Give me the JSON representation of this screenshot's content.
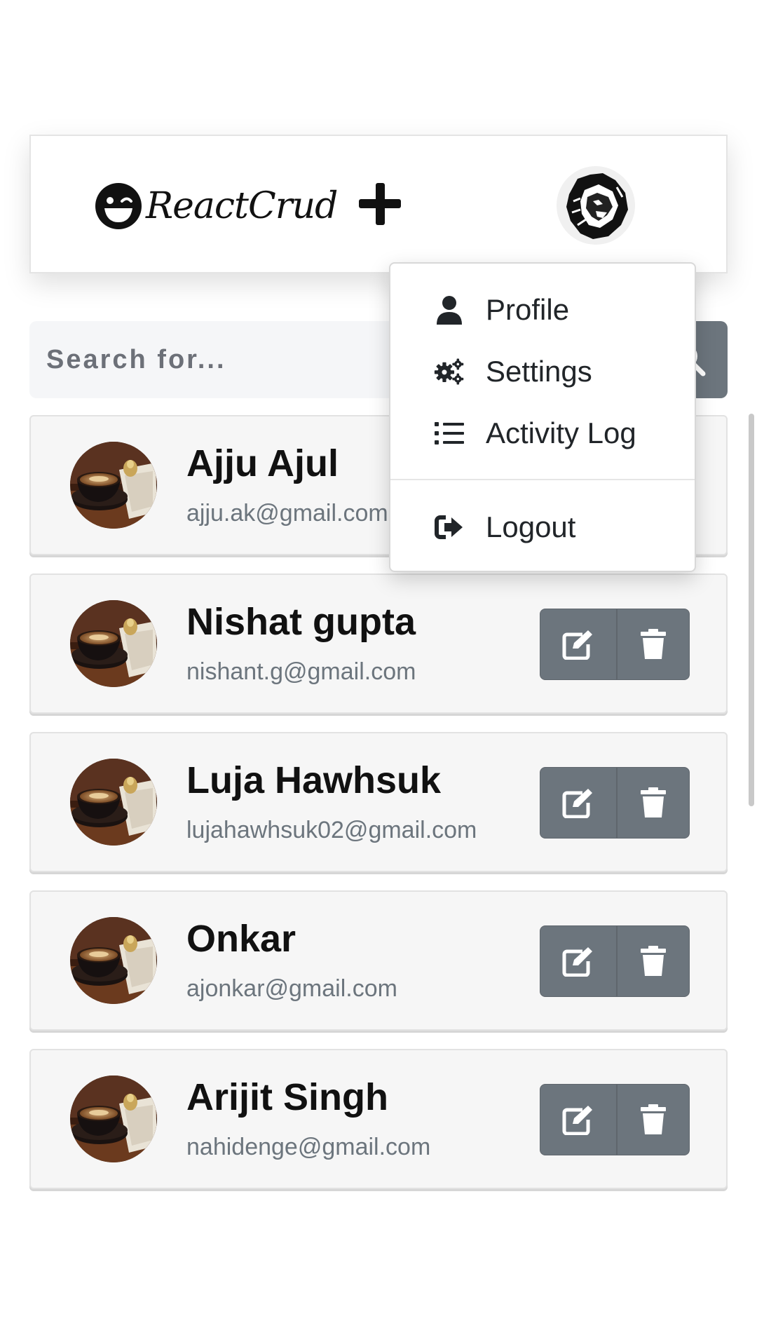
{
  "navbar": {
    "brand_name": "ReactCrud",
    "brand_icon": "winking-smiley-icon",
    "add_icon": "plus-icon",
    "profile_avatar": "lion-avatar"
  },
  "search": {
    "placeholder": "Search for...",
    "button_icon": "search-icon"
  },
  "users": [
    {
      "name": "Ajju Ajul",
      "email": "ajju.ak@gmail.com"
    },
    {
      "name": "Nishat gupta",
      "email": "nishant.g@gmail.com"
    },
    {
      "name": "Luja Hawhsuk",
      "email": "lujahawhsuk02@gmail.com"
    },
    {
      "name": "Onkar",
      "email": "ajonkar@gmail.com"
    },
    {
      "name": "Arijit Singh",
      "email": "nahidenge@gmail.com"
    }
  ],
  "row_actions": {
    "edit_icon": "edit-icon",
    "delete_icon": "trash-icon"
  },
  "dropdown": {
    "items": [
      {
        "label": "Profile",
        "icon": "user-icon"
      },
      {
        "label": "Settings",
        "icon": "gears-icon"
      },
      {
        "label": "Activity Log",
        "icon": "list-icon"
      }
    ],
    "logout": {
      "label": "Logout",
      "icon": "sign-out-icon"
    }
  },
  "colors": {
    "button_gray": "#6c757d",
    "card_bg": "#f6f6f6",
    "email_text": "#6c757d",
    "search_bg": "#f5f6f8"
  }
}
